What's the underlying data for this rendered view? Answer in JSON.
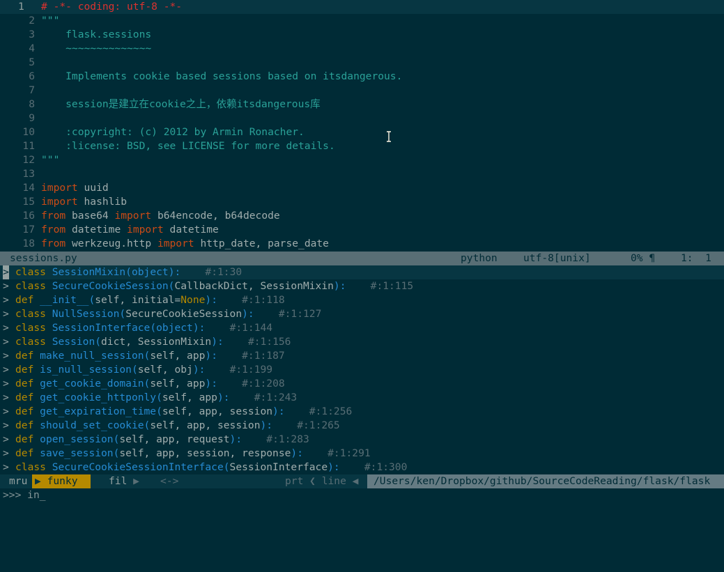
{
  "editor": {
    "lines": [
      {
        "num": "1",
        "current": true,
        "tokens": [
          {
            "t": "# -*- coding: utf-8 -*-",
            "c": "c-comment"
          }
        ]
      },
      {
        "num": "2",
        "tokens": [
          {
            "t": "\"\"\"",
            "c": "c-string"
          }
        ]
      },
      {
        "num": "3",
        "tokens": [
          {
            "t": "    flask.sessions",
            "c": "c-string"
          }
        ]
      },
      {
        "num": "4",
        "tokens": [
          {
            "t": "    ~~~~~~~~~~~~~~",
            "c": "c-string"
          }
        ]
      },
      {
        "num": "5",
        "tokens": [
          {
            "t": "",
            "c": "c-string"
          }
        ]
      },
      {
        "num": "6",
        "tokens": [
          {
            "t": "    Implements cookie based sessions based on itsdangerous.",
            "c": "c-string"
          }
        ]
      },
      {
        "num": "7",
        "tokens": [
          {
            "t": "",
            "c": "c-string"
          }
        ]
      },
      {
        "num": "8",
        "tokens": [
          {
            "t": "    session是建立在cookie之上，依赖itsdangerous库",
            "c": "c-string"
          }
        ]
      },
      {
        "num": "9",
        "tokens": [
          {
            "t": "",
            "c": "c-string"
          }
        ]
      },
      {
        "num": "10",
        "tokens": [
          {
            "t": "    :copyright: (c) 2012 by Armin Ronacher.",
            "c": "c-string"
          }
        ]
      },
      {
        "num": "11",
        "tokens": [
          {
            "t": "    :license: BSD, see LICENSE for more details.",
            "c": "c-string"
          }
        ]
      },
      {
        "num": "12",
        "tokens": [
          {
            "t": "\"\"\"",
            "c": "c-string"
          }
        ]
      },
      {
        "num": "13",
        "tokens": [
          {
            "t": "",
            "c": "c-plain"
          }
        ]
      },
      {
        "num": "14",
        "tokens": [
          {
            "t": "import",
            "c": "c-kw"
          },
          {
            "t": " uuid",
            "c": "c-plain"
          }
        ]
      },
      {
        "num": "15",
        "tokens": [
          {
            "t": "import",
            "c": "c-kw"
          },
          {
            "t": " hashlib",
            "c": "c-plain"
          }
        ]
      },
      {
        "num": "16",
        "tokens": [
          {
            "t": "from",
            "c": "c-kw"
          },
          {
            "t": " base64 ",
            "c": "c-plain"
          },
          {
            "t": "import",
            "c": "c-kw"
          },
          {
            "t": " b64encode, b64decode",
            "c": "c-plain"
          }
        ]
      },
      {
        "num": "17",
        "tokens": [
          {
            "t": "from",
            "c": "c-kw"
          },
          {
            "t": " datetime ",
            "c": "c-plain"
          },
          {
            "t": "import",
            "c": "c-kw"
          },
          {
            "t": " datetime",
            "c": "c-plain"
          }
        ]
      },
      {
        "num": "18",
        "tokens": [
          {
            "t": "from",
            "c": "c-kw"
          },
          {
            "t": " werkzeug.http ",
            "c": "c-plain"
          },
          {
            "t": "import",
            "c": "c-kw"
          },
          {
            "t": " http_date, parse_date",
            "c": "c-plain"
          }
        ]
      }
    ]
  },
  "statusline": {
    "filename": "sessions.py",
    "filetype": "python",
    "encoding": "utf-8[unix]",
    "percent": "0% ¶",
    "position": "1:  1"
  },
  "results": [
    {
      "selected": true,
      "kw": "class",
      "name": "SessionMixin",
      "args": [
        {
          "t": "(",
          "c": "c-fn"
        },
        {
          "t": "object",
          "c": "c-fn"
        },
        {
          "t": "):",
          "c": "c-fn"
        }
      ],
      "tag": "#:1:30"
    },
    {
      "kw": "class",
      "name": "SecureCookieSession",
      "args": [
        {
          "t": "(",
          "c": "c-fn"
        },
        {
          "t": "CallbackDict, SessionMixin",
          "c": "c-plain"
        },
        {
          "t": "):",
          "c": "c-fn"
        }
      ],
      "tag": "#:1:115"
    },
    {
      "kw": "def",
      "name": "__init__",
      "args": [
        {
          "t": "(",
          "c": "c-fn"
        },
        {
          "t": "self, initial=",
          "c": "c-plain"
        },
        {
          "t": "None",
          "c": "c-kw2"
        },
        {
          "t": "):",
          "c": "c-fn"
        }
      ],
      "tag": "#:1:118"
    },
    {
      "kw": "class",
      "name": "NullSession",
      "args": [
        {
          "t": "(",
          "c": "c-fn"
        },
        {
          "t": "SecureCookieSession",
          "c": "c-plain"
        },
        {
          "t": "):",
          "c": "c-fn"
        }
      ],
      "tag": "#:1:127"
    },
    {
      "kw": "class",
      "name": "SessionInterface",
      "args": [
        {
          "t": "(",
          "c": "c-fn"
        },
        {
          "t": "object",
          "c": "c-fn"
        },
        {
          "t": "):",
          "c": "c-fn"
        }
      ],
      "tag": "#:1:144"
    },
    {
      "kw": "class",
      "name": "Session",
      "args": [
        {
          "t": "(",
          "c": "c-fn"
        },
        {
          "t": "dict, SessionMixin",
          "c": "c-plain"
        },
        {
          "t": "):",
          "c": "c-fn"
        }
      ],
      "tag": "#:1:156"
    },
    {
      "kw": "def",
      "name": "make_null_session",
      "args": [
        {
          "t": "(",
          "c": "c-fn"
        },
        {
          "t": "self, app",
          "c": "c-plain"
        },
        {
          "t": "):",
          "c": "c-fn"
        }
      ],
      "tag": "#:1:187"
    },
    {
      "kw": "def",
      "name": "is_null_session",
      "args": [
        {
          "t": "(",
          "c": "c-fn"
        },
        {
          "t": "self, obj",
          "c": "c-plain"
        },
        {
          "t": "):",
          "c": "c-fn"
        }
      ],
      "tag": "#:1:199"
    },
    {
      "kw": "def",
      "name": "get_cookie_domain",
      "args": [
        {
          "t": "(",
          "c": "c-fn"
        },
        {
          "t": "self, app",
          "c": "c-plain"
        },
        {
          "t": "):",
          "c": "c-fn"
        }
      ],
      "tag": "#:1:208"
    },
    {
      "kw": "def",
      "name": "get_cookie_httponly",
      "args": [
        {
          "t": "(",
          "c": "c-fn"
        },
        {
          "t": "self, app",
          "c": "c-plain"
        },
        {
          "t": "):",
          "c": "c-fn"
        }
      ],
      "tag": "#:1:243"
    },
    {
      "kw": "def",
      "name": "get_expiration_time",
      "args": [
        {
          "t": "(",
          "c": "c-fn"
        },
        {
          "t": "self, app, session",
          "c": "c-plain"
        },
        {
          "t": "):",
          "c": "c-fn"
        }
      ],
      "tag": "#:1:256"
    },
    {
      "kw": "def",
      "name": "should_set_cookie",
      "args": [
        {
          "t": "(",
          "c": "c-fn"
        },
        {
          "t": "self, app, session",
          "c": "c-plain"
        },
        {
          "t": "):",
          "c": "c-fn"
        }
      ],
      "tag": "#:1:265"
    },
    {
      "kw": "def",
      "name": "open_session",
      "args": [
        {
          "t": "(",
          "c": "c-fn"
        },
        {
          "t": "self, app, request",
          "c": "c-plain"
        },
        {
          "t": "):",
          "c": "c-fn"
        }
      ],
      "tag": "#:1:283"
    },
    {
      "kw": "def",
      "name": "save_session",
      "args": [
        {
          "t": "(",
          "c": "c-fn"
        },
        {
          "t": "self, app, session, response",
          "c": "c-plain"
        },
        {
          "t": "):",
          "c": "c-fn"
        }
      ],
      "tag": "#:1:291"
    },
    {
      "kw": "class",
      "name": "SecureCookieSessionInterface",
      "args": [
        {
          "t": "(",
          "c": "c-fn"
        },
        {
          "t": "SessionInterface",
          "c": "c-plain"
        },
        {
          "t": "):",
          "c": "c-fn"
        }
      ],
      "tag": "#:1:300"
    }
  ],
  "ctrlp": {
    "mode_prev": "mru",
    "mode_current": "funky",
    "mode_next": "fil",
    "arrows": "<->",
    "prt": "prt ❮ line ◀",
    "path": "/Users/ken/Dropbox/github/SourceCodeReading/flask/flask"
  },
  "prompt": {
    "prefix": ">>> ",
    "input": "in",
    "cursor": "_"
  },
  "colors": {
    "background": "#002b36",
    "selection": "#073642",
    "keyword": "#cb4b16",
    "string": "#2aa198",
    "function": "#268bd2",
    "mode_accent": "#b58900"
  },
  "icons": {
    "text_cursor": "i-beam-icon",
    "selection_marker": "chevron-right-icon"
  }
}
